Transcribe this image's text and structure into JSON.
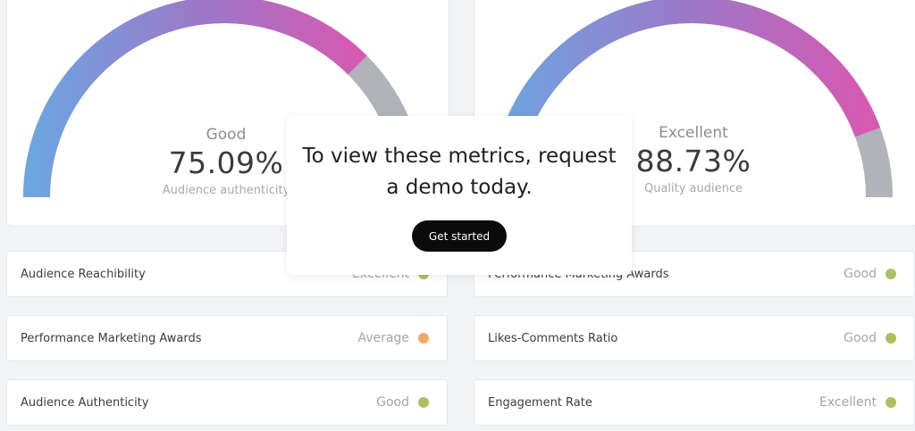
{
  "gauges": [
    {
      "status": "Good",
      "value": "75.09%",
      "caption": "Audience authenticity",
      "fraction": 0.7509
    },
    {
      "status": "Excellent",
      "value": "88.73%",
      "caption": "Quality audience",
      "fraction": 0.8873
    }
  ],
  "metrics_left": [
    {
      "label": "Audience Reachibility",
      "status": "Excellent",
      "color": "#a9c25f"
    },
    {
      "label": "Performance Marketing Awards",
      "status": "Average",
      "color": "#f0a76a"
    },
    {
      "label": "Audience Authenticity",
      "status": "Good",
      "color": "#a9c25f"
    }
  ],
  "metrics_right": [
    {
      "label": "Performance Marketing Awards",
      "status": "Good",
      "color": "#a9c25f"
    },
    {
      "label": "Likes-Comments Ratio",
      "status": "Good",
      "color": "#a9c25f"
    },
    {
      "label": "Engagement Rate",
      "status": "Excellent",
      "color": "#a9c25f"
    }
  ],
  "modal": {
    "line1": "To view these metrics, request",
    "line2": "a demo today.",
    "button_label": "Get started"
  },
  "colors": {
    "gauge_start": "#6ea4e0",
    "gauge_mid": "#9b79c8",
    "gauge_end": "#d659b2",
    "gauge_track": "#b0b3b8",
    "button": "#0b0b0b"
  }
}
